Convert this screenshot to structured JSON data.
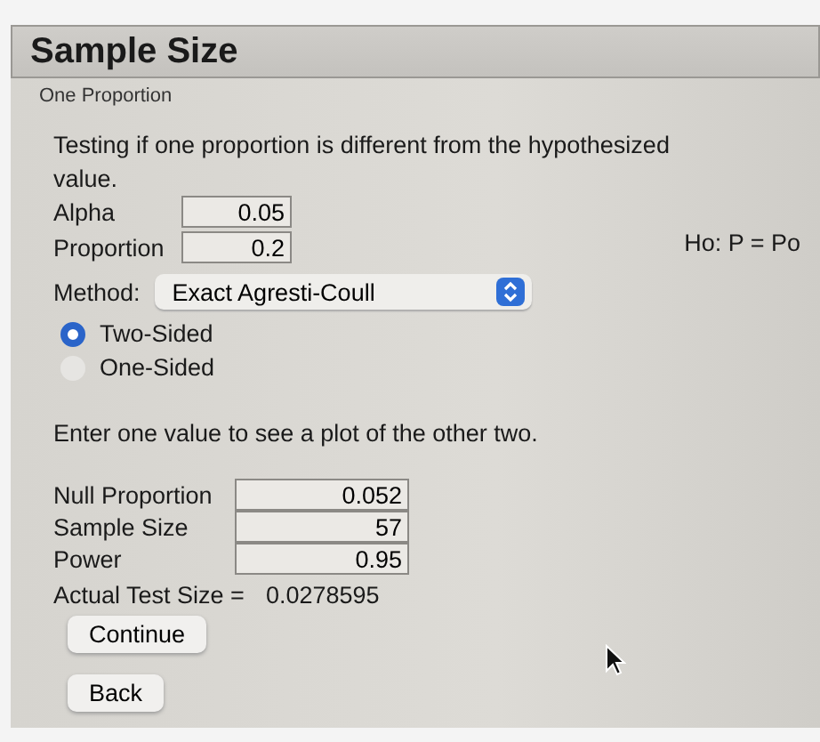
{
  "title": "Sample Size",
  "subtitle": "One Proportion",
  "description": "Testing if one proportion is different from the hypothesized value.",
  "inputs": [
    {
      "label": "Alpha",
      "value": "0.05"
    },
    {
      "label": "Proportion",
      "value": "0.2"
    }
  ],
  "hypothesis": "Ho: P = Po",
  "method": {
    "label": "Method:",
    "value": "Exact Agresti-Coull"
  },
  "sides": [
    {
      "label": "Two-Sided",
      "selected": true
    },
    {
      "label": "One-Sided",
      "selected": false
    }
  ],
  "instruction": "Enter one value to see a plot of the other two.",
  "values": [
    {
      "label": "Null Proportion",
      "value": "0.052"
    },
    {
      "label": "Sample Size",
      "value": "57"
    },
    {
      "label": "Power",
      "value": "0.95"
    }
  ],
  "actual_test_size": {
    "label": "Actual Test Size =",
    "value": "0.0278595"
  },
  "buttons": [
    "Continue",
    "Back"
  ]
}
